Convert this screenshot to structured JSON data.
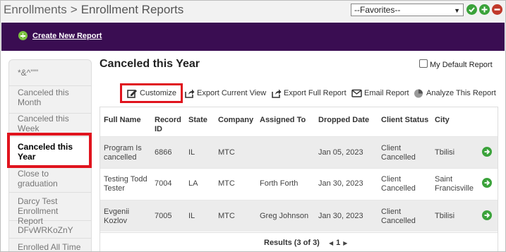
{
  "header": {
    "breadcrumb_parent": "Enrollments",
    "breadcrumb_separator": ">",
    "breadcrumb_current": "Enrollment Reports",
    "favorites_selected": "--Favorites--"
  },
  "banner": {
    "create_label": "Create New Report"
  },
  "sidebar": {
    "items": [
      {
        "label": "*&^'\"\"",
        "active": false
      },
      {
        "label": "Canceled this Month",
        "active": false
      },
      {
        "label": "Canceled this Week",
        "active": false
      },
      {
        "label": "Canceled this Year",
        "active": true
      },
      {
        "label": "Close to graduation",
        "active": false
      },
      {
        "label": "Darcy Test Enrollment Report",
        "active": false
      },
      {
        "label": "DFvWRKoZnY",
        "active": false
      },
      {
        "label": "Enrolled All Time",
        "active": false
      }
    ]
  },
  "report": {
    "title": "Canceled this Year",
    "default_label": "My Default Report",
    "toolbar": {
      "customize": "Customize",
      "export_current": "Export Current View",
      "export_full": "Export Full Report",
      "email": "Email Report",
      "analyze": "Analyze This Report"
    },
    "columns": [
      "Full Name",
      "Record ID",
      "State",
      "Company",
      "Assigned To",
      "Dropped Date",
      "Client Status",
      "City"
    ],
    "rows": [
      {
        "name": "Program Is cancelled",
        "id": "6866",
        "state": "IL",
        "company": "MTC",
        "assigned": "",
        "dropped": "Jan 05, 2023",
        "status": "Client Cancelled",
        "city": "Tbilisi"
      },
      {
        "name": "Testing Todd Tester",
        "id": "7004",
        "state": "LA",
        "company": "MTC",
        "assigned": "Forth Forth",
        "dropped": "Jan 30, 2023",
        "status": "Client Cancelled",
        "city": "Saint Francisville"
      },
      {
        "name": "Evgenii Kozlov",
        "id": "7005",
        "state": "IL",
        "company": "MTC",
        "assigned": "Greg Johnson",
        "dropped": "Jan 30, 2023",
        "status": "Client Cancelled",
        "city": "Tbilisi"
      }
    ],
    "results_text": "Results (3 of 3)",
    "page": "1"
  },
  "colors": {
    "banner": "#3a0d52",
    "highlight": "#e0141e",
    "go": "#3aa23a"
  }
}
